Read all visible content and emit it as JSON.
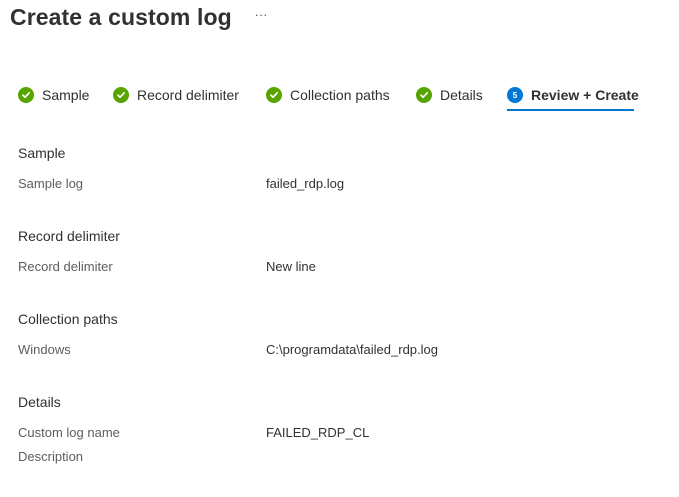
{
  "header": {
    "title": "Create a custom log",
    "more_label": "···"
  },
  "steps": [
    {
      "label": "Sample",
      "status": "done",
      "icon": "check-circle-icon"
    },
    {
      "label": "Record delimiter",
      "status": "done",
      "icon": "check-circle-icon"
    },
    {
      "label": "Collection paths",
      "status": "done",
      "icon": "check-circle-icon"
    },
    {
      "label": "Details",
      "status": "done",
      "icon": "check-circle-icon"
    },
    {
      "label": "Review + Create",
      "status": "current",
      "number": "5",
      "icon": "step-number-icon"
    }
  ],
  "sections": {
    "sample": {
      "heading": "Sample",
      "fields": [
        {
          "label": "Sample log",
          "value": "failed_rdp.log"
        }
      ]
    },
    "record_delimiter": {
      "heading": "Record delimiter",
      "fields": [
        {
          "label": "Record delimiter",
          "value": "New line"
        }
      ]
    },
    "collection_paths": {
      "heading": "Collection paths",
      "fields": [
        {
          "label": "Windows",
          "value": "C:\\programdata\\failed_rdp.log"
        }
      ]
    },
    "details": {
      "heading": "Details",
      "fields": [
        {
          "label": "Custom log name",
          "value": "FAILED_RDP_CL"
        },
        {
          "label": "Description",
          "value": ""
        }
      ]
    }
  },
  "colors": {
    "success": "#57a300",
    "accent": "#0078d4",
    "text": "#323130",
    "muted": "#605e5c"
  }
}
